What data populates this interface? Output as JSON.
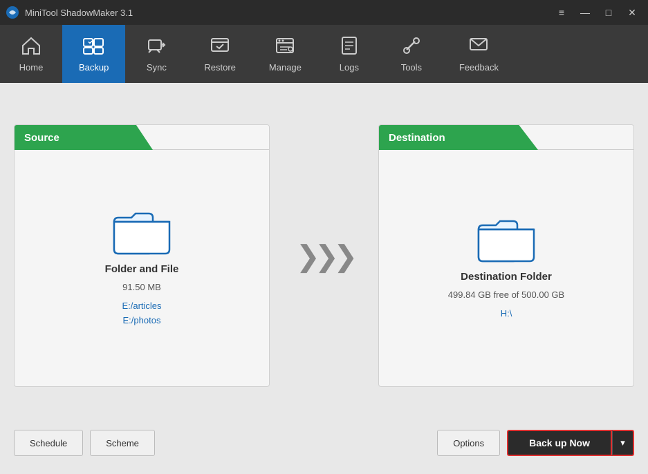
{
  "titleBar": {
    "title": "MiniTool ShadowMaker 3.1",
    "menuIcon": "≡",
    "minimizeIcon": "—",
    "maximizeIcon": "□",
    "closeIcon": "✕"
  },
  "nav": {
    "items": [
      {
        "id": "home",
        "label": "Home",
        "active": false
      },
      {
        "id": "backup",
        "label": "Backup",
        "active": true
      },
      {
        "id": "sync",
        "label": "Sync",
        "active": false
      },
      {
        "id": "restore",
        "label": "Restore",
        "active": false
      },
      {
        "id": "manage",
        "label": "Manage",
        "active": false
      },
      {
        "id": "logs",
        "label": "Logs",
        "active": false
      },
      {
        "id": "tools",
        "label": "Tools",
        "active": false
      },
      {
        "id": "feedback",
        "label": "Feedback",
        "active": false
      }
    ]
  },
  "source": {
    "header": "Source",
    "title": "Folder and File",
    "size": "91.50 MB",
    "paths": [
      "E:/articles",
      "E:/photos"
    ]
  },
  "destination": {
    "header": "Destination",
    "title": "Destination Folder",
    "size": "499.84 GB free of 500.00 GB",
    "path": "H:\\"
  },
  "bottomBar": {
    "schedule": "Schedule",
    "scheme": "Scheme",
    "options": "Options",
    "backupNow": "Back up Now",
    "dropdownArrow": "▾"
  }
}
